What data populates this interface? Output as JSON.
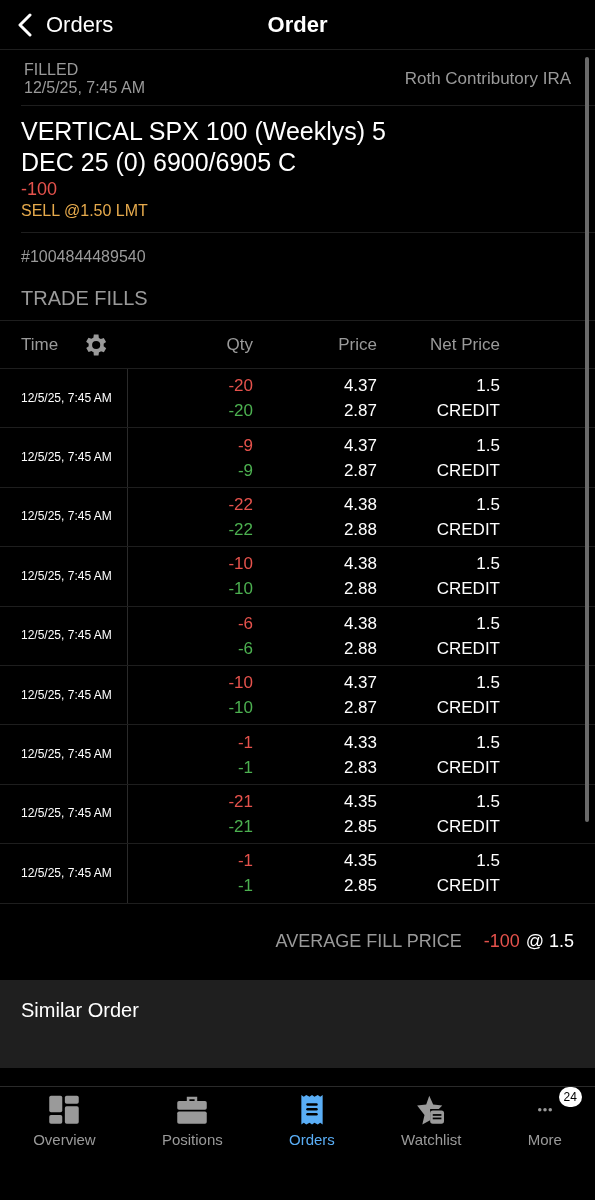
{
  "nav": {
    "back_label": "Orders",
    "title": "Order"
  },
  "order": {
    "status": "FILLED",
    "time": "12/5/25, 7:45 AM",
    "account": "Roth Contributory IRA",
    "description": "VERTICAL SPX 100 (Weeklys) 5 DEC 25 (0) 6900/6905 C",
    "quantity": "-100",
    "instruction": "SELL @1.50 LMT",
    "number": "#1004844489540"
  },
  "fills": {
    "title": "TRADE FILLS",
    "columns": [
      "Time",
      "Qty",
      "Price",
      "Net Price"
    ],
    "rows": [
      {
        "time": "12/5/25, 7:45 AM",
        "legs": [
          {
            "color": "#e5524c",
            "qty": "-20",
            "price": "4.37"
          },
          {
            "color": "#4cb050",
            "qty": "-20",
            "price": "2.87"
          }
        ],
        "net_price": "1.5",
        "net_type": "CREDIT"
      },
      {
        "time": "12/5/25, 7:45 AM",
        "legs": [
          {
            "color": "#e5524c",
            "qty": "-9",
            "price": "4.37"
          },
          {
            "color": "#4cb050",
            "qty": "-9",
            "price": "2.87"
          }
        ],
        "net_price": "1.5",
        "net_type": "CREDIT"
      },
      {
        "time": "12/5/25, 7:45 AM",
        "legs": [
          {
            "color": "#e5524c",
            "qty": "-22",
            "price": "4.38"
          },
          {
            "color": "#4cb050",
            "qty": "-22",
            "price": "2.88"
          }
        ],
        "net_price": "1.5",
        "net_type": "CREDIT"
      },
      {
        "time": "12/5/25, 7:45 AM",
        "legs": [
          {
            "color": "#e5524c",
            "qty": "-10",
            "price": "4.38"
          },
          {
            "color": "#4cb050",
            "qty": "-10",
            "price": "2.88"
          }
        ],
        "net_price": "1.5",
        "net_type": "CREDIT"
      },
      {
        "time": "12/5/25, 7:45 AM",
        "legs": [
          {
            "color": "#e5524c",
            "qty": "-6",
            "price": "4.38"
          },
          {
            "color": "#4cb050",
            "qty": "-6",
            "price": "2.88"
          }
        ],
        "net_price": "1.5",
        "net_type": "CREDIT"
      },
      {
        "time": "12/5/25, 7:45 AM",
        "legs": [
          {
            "color": "#e5524c",
            "qty": "-10",
            "price": "4.37"
          },
          {
            "color": "#4cb050",
            "qty": "-10",
            "price": "2.87"
          }
        ],
        "net_price": "1.5",
        "net_type": "CREDIT"
      },
      {
        "time": "12/5/25, 7:45 AM",
        "legs": [
          {
            "color": "#e5524c",
            "qty": "-1",
            "price": "4.33"
          },
          {
            "color": "#4cb050",
            "qty": "-1",
            "price": "2.83"
          }
        ],
        "net_price": "1.5",
        "net_type": "CREDIT"
      },
      {
        "time": "12/5/25, 7:45 AM",
        "legs": [
          {
            "color": "#e5524c",
            "qty": "-21",
            "price": "4.35"
          },
          {
            "color": "#4cb050",
            "qty": "-21",
            "price": "2.85"
          }
        ],
        "net_price": "1.5",
        "net_type": "CREDIT"
      },
      {
        "time": "12/5/25, 7:45 AM",
        "legs": [
          {
            "color": "#e5524c",
            "qty": "-1",
            "price": "4.35"
          },
          {
            "color": "#4cb050",
            "qty": "-1",
            "price": "2.85"
          }
        ],
        "net_price": "1.5",
        "net_type": "CREDIT"
      }
    ],
    "average": {
      "label": "AVERAGE FILL PRICE",
      "quantity": "-100",
      "price": "@ 1.5"
    }
  },
  "actions": [
    "Similar Order"
  ],
  "tab_bar": [
    {
      "kind": "overview",
      "label": "Overview",
      "selected": false
    },
    {
      "kind": "positions",
      "label": "Positions",
      "selected": false
    },
    {
      "kind": "orders",
      "label": "Orders",
      "selected": true
    },
    {
      "kind": "watchlist",
      "label": "Watchlist",
      "selected": false
    },
    {
      "kind": "more",
      "label": "More",
      "selected": false,
      "badge": "24"
    }
  ]
}
